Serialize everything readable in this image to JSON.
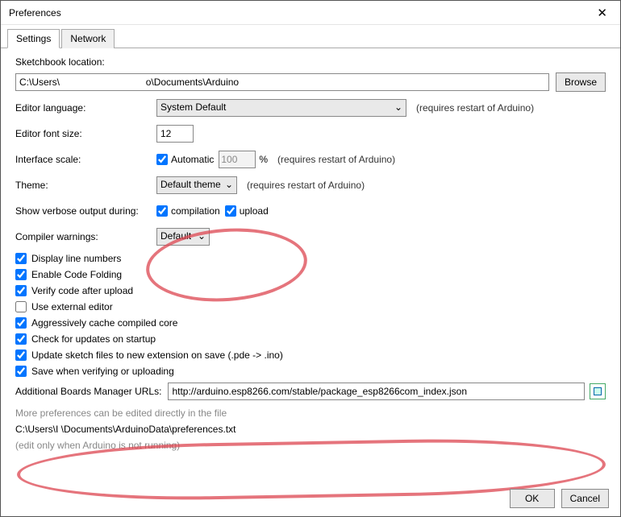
{
  "window": {
    "title": "Preferences"
  },
  "tabs": {
    "settings": "Settings",
    "network": "Network"
  },
  "loc": {
    "label": "Sketchbook location:",
    "value": "C:\\Users\\                                o\\Documents\\Arduino",
    "browse": "Browse"
  },
  "lang": {
    "label": "Editor language:",
    "value": "System Default",
    "hint": "(requires restart of Arduino)"
  },
  "font": {
    "label": "Editor font size:",
    "value": "12"
  },
  "scale": {
    "label": "Interface scale:",
    "auto": "Automatic",
    "value": "100",
    "pct": "%",
    "hint": "(requires restart of Arduino)"
  },
  "theme": {
    "label": "Theme:",
    "value": "Default theme",
    "hint": "(requires restart of Arduino)"
  },
  "verbose": {
    "label": "Show verbose output during:",
    "comp": "compilation",
    "upl": "upload"
  },
  "warn": {
    "label": "Compiler warnings:",
    "value": "Default"
  },
  "opts": {
    "lines": "Display line numbers",
    "fold": "Enable Code Folding",
    "verify": "Verify code after upload",
    "ext": "Use external editor",
    "cache": "Aggressively cache compiled core",
    "updates": "Check for updates on startup",
    "extnew": "Update sketch files to new extension on save (.pde -> .ino)",
    "save": "Save when verifying or uploading"
  },
  "urls": {
    "label": "Additional Boards Manager URLs:",
    "value": "http://arduino.esp8266.com/stable/package_esp8266com_index.json"
  },
  "more": {
    "hint": "More preferences can be edited directly in the file",
    "path": "C:\\Users\\I                           \\Documents\\ArduinoData\\preferences.txt",
    "note": "(edit only when Arduino is not running)"
  },
  "footer": {
    "ok": "OK",
    "cancel": "Cancel"
  }
}
